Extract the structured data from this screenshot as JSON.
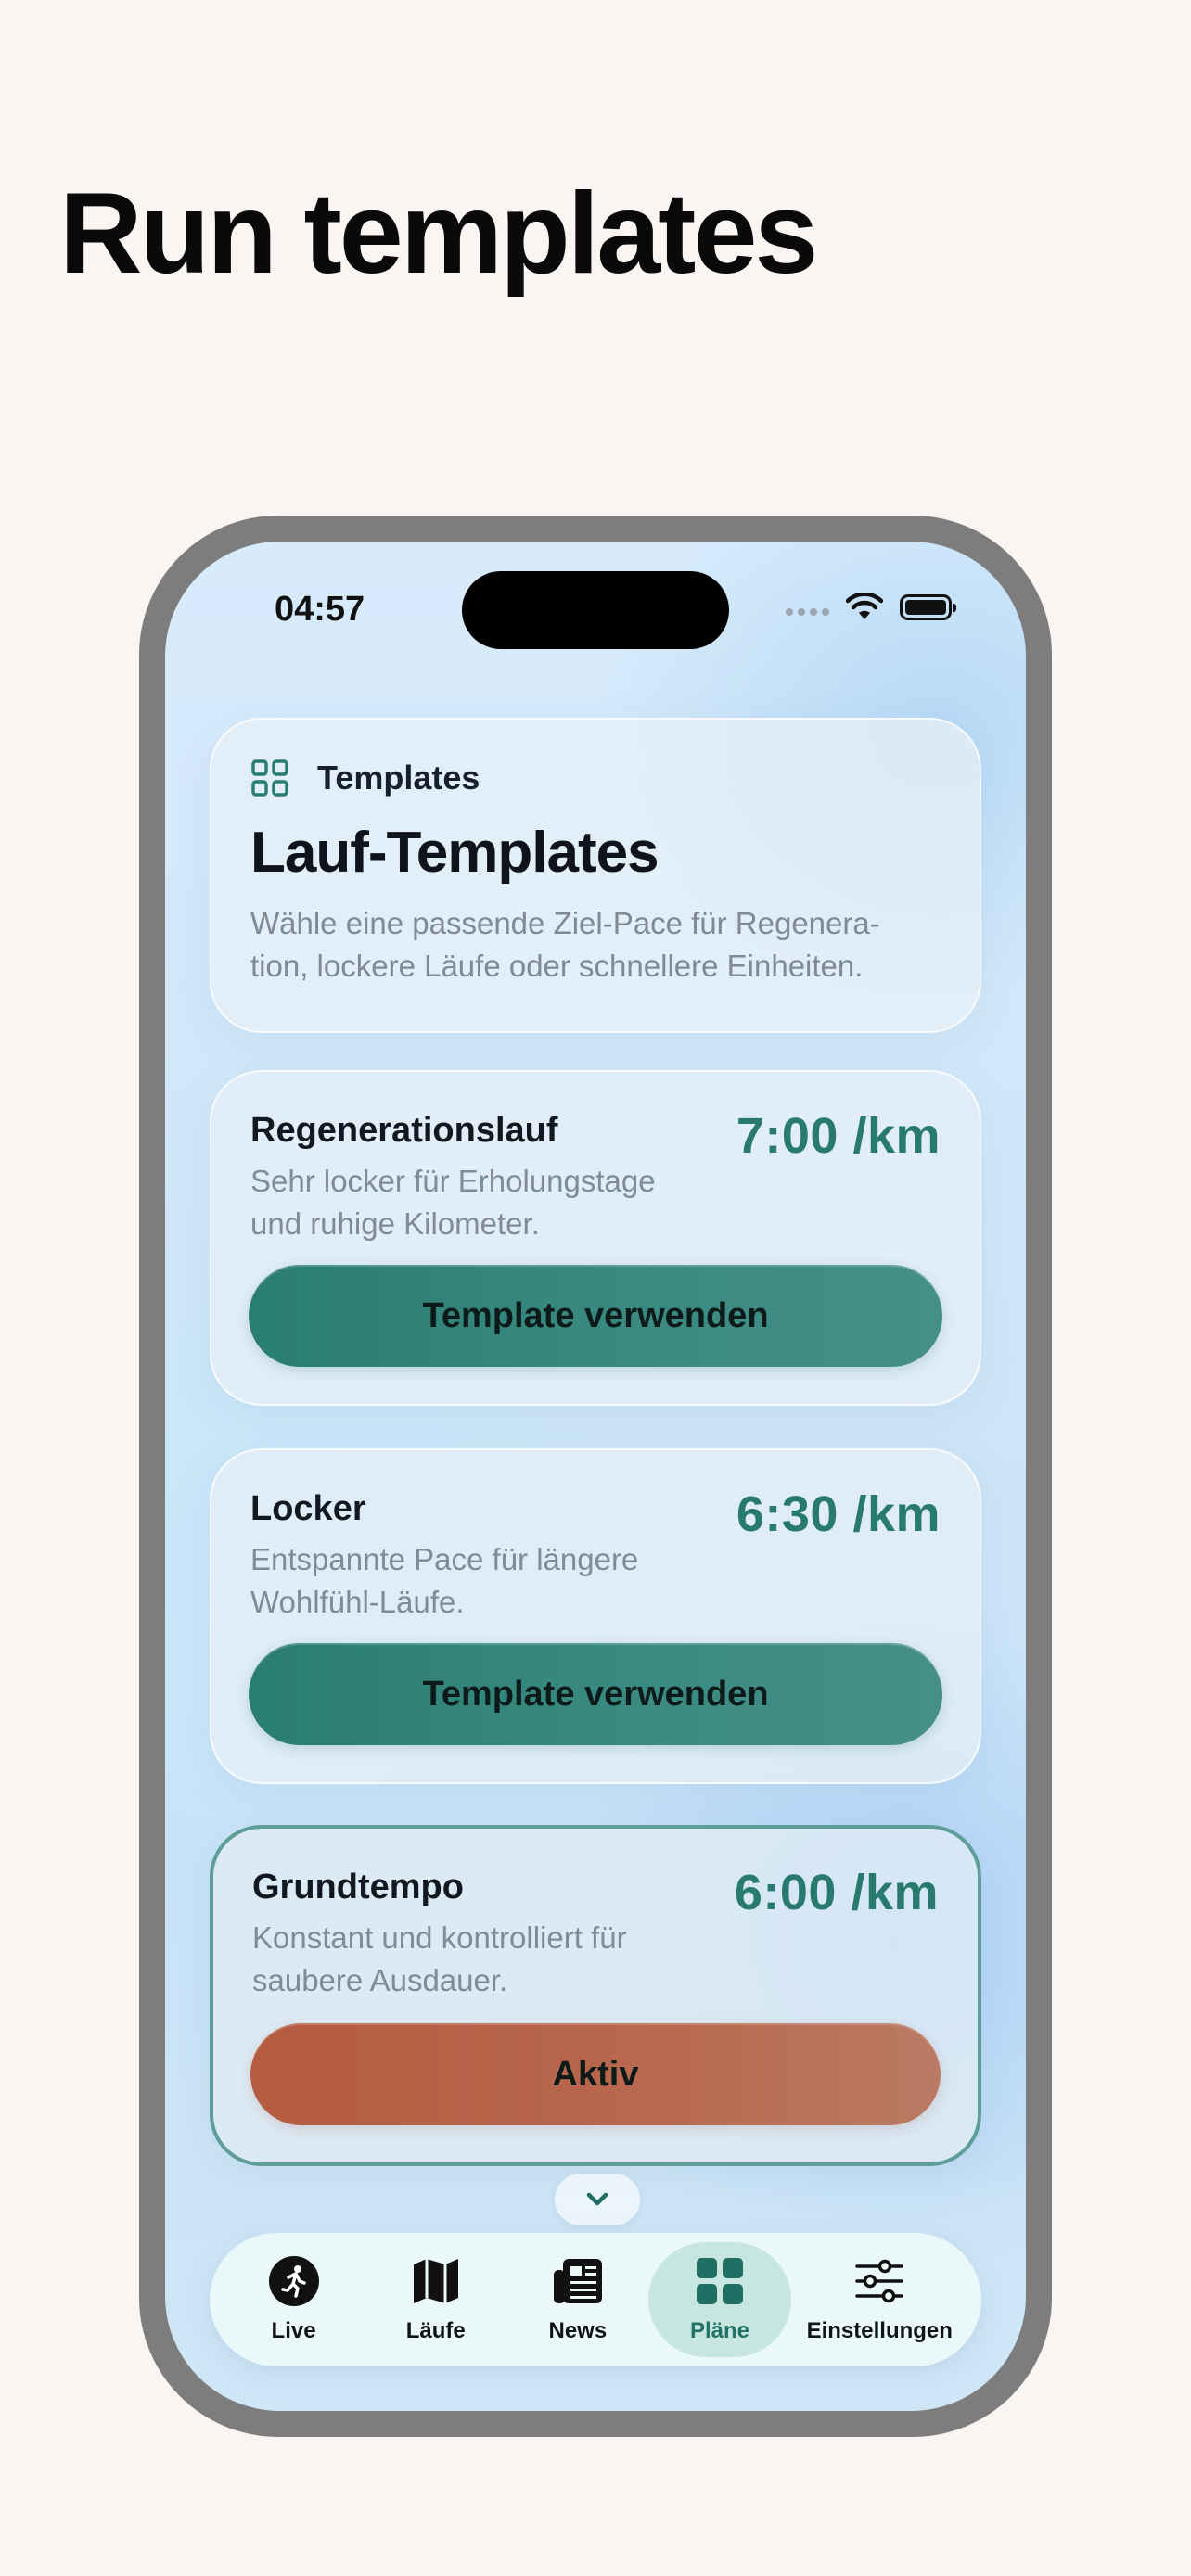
{
  "headline": "Run templates",
  "status_bar": {
    "time": "04:57"
  },
  "header_card": {
    "kicker": "Templates",
    "title": "Lauf-Templates",
    "description": "Wähle eine passende Ziel-Pace für Regenera-tion, lockere Läufe oder schnellere Einheiten."
  },
  "templates": [
    {
      "name": "Regenerationslauf",
      "description": "Sehr locker für Erholungstage und ruhige Kilometer.",
      "pace": "7:00 /km",
      "button_label": "Template verwenden",
      "active": false
    },
    {
      "name": "Locker",
      "description": "Entspannte Pace für längere Wohlfühl-Läufe.",
      "pace": "6:30 /km",
      "button_label": "Template verwenden",
      "active": false
    },
    {
      "name": "Grundtempo",
      "description": "Konstant und kontrolliert für saubere Ausdauer.",
      "pace": "6:00 /km",
      "button_label": "Aktiv",
      "active": true
    }
  ],
  "tabbar": {
    "items": [
      {
        "label": "Live",
        "icon": "runner-icon"
      },
      {
        "label": "Läufe",
        "icon": "map-icon"
      },
      {
        "label": "News",
        "icon": "newspaper-icon"
      },
      {
        "label": "Pläne",
        "icon": "grid-icon",
        "selected": true
      },
      {
        "label": "Einstellungen",
        "icon": "sliders-icon"
      }
    ]
  },
  "colors": {
    "accent_teal": "#287a6f",
    "active_orange": "#b45b40",
    "page_background": "#faf5f2"
  }
}
